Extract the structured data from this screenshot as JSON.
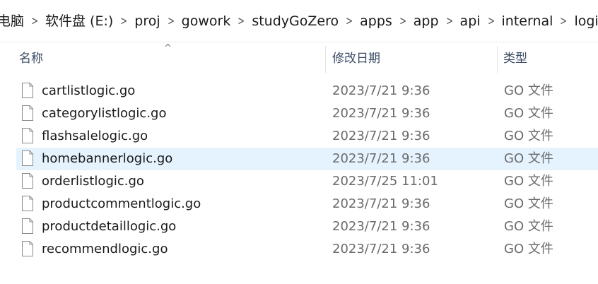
{
  "breadcrumb": {
    "items": [
      "电脑",
      "软件盘 (E:)",
      "proj",
      "gowork",
      "studyGoZero",
      "apps",
      "app",
      "api",
      "internal",
      "logic"
    ]
  },
  "columns": {
    "name": "名称",
    "date": "修改日期",
    "type": "类型"
  },
  "files": [
    {
      "name": "cartlistlogic.go",
      "date": "2023/7/21 9:36",
      "type": "GO 文件",
      "selected": false
    },
    {
      "name": "categorylistlogic.go",
      "date": "2023/7/21 9:36",
      "type": "GO 文件",
      "selected": false
    },
    {
      "name": "flashsalelogic.go",
      "date": "2023/7/21 9:36",
      "type": "GO 文件",
      "selected": false
    },
    {
      "name": "homebannerlogic.go",
      "date": "2023/7/21 9:36",
      "type": "GO 文件",
      "selected": true
    },
    {
      "name": "orderlistlogic.go",
      "date": "2023/7/25 11:01",
      "type": "GO 文件",
      "selected": false
    },
    {
      "name": "productcommentlogic.go",
      "date": "2023/7/21 9:36",
      "type": "GO 文件",
      "selected": false
    },
    {
      "name": "productdetaillogic.go",
      "date": "2023/7/21 9:36",
      "type": "GO 文件",
      "selected": false
    },
    {
      "name": "recommendlogic.go",
      "date": "2023/7/21 9:36",
      "type": "GO 文件",
      "selected": false
    }
  ],
  "icons": {
    "sort": "sort-ascending-icon",
    "file": "file-icon",
    "separator": "chevron-right-icon"
  },
  "colors": {
    "selection": "#e5f3ff",
    "header_text": "#3a4a63",
    "secondary_text": "#6b6b6b"
  }
}
